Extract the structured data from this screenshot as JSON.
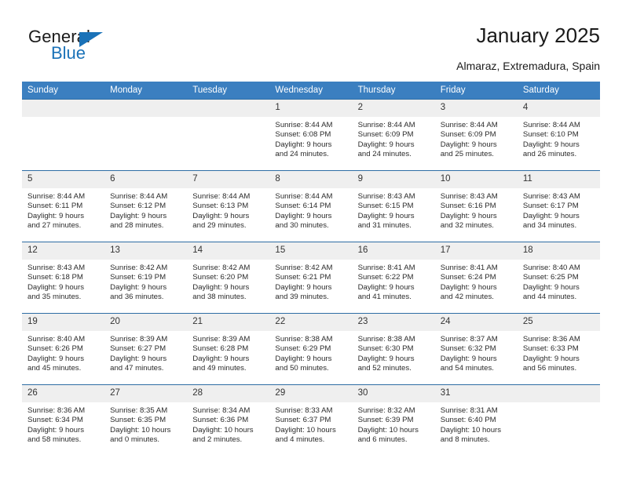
{
  "logo": {
    "word1": "General",
    "word2": "Blue",
    "triangle_color": "#1a72b8"
  },
  "header": {
    "title": "January 2025",
    "location": "Almaraz, Extremadura, Spain"
  },
  "theme": {
    "header_blue": "#3b7fc0",
    "border_blue": "#2e6da4",
    "daynum_bg": "#efefef",
    "text": "#2b2b2b"
  },
  "weekday_headers": [
    "Sunday",
    "Monday",
    "Tuesday",
    "Wednesday",
    "Thursday",
    "Friday",
    "Saturday"
  ],
  "weeks": [
    [
      {
        "day": "",
        "blank": true,
        "sunrise": "",
        "sunset": "",
        "daylight1": "",
        "daylight2": ""
      },
      {
        "day": "",
        "blank": true,
        "sunrise": "",
        "sunset": "",
        "daylight1": "",
        "daylight2": ""
      },
      {
        "day": "",
        "blank": true,
        "sunrise": "",
        "sunset": "",
        "daylight1": "",
        "daylight2": ""
      },
      {
        "day": "1",
        "blank": false,
        "sunrise": "Sunrise: 8:44 AM",
        "sunset": "Sunset: 6:08 PM",
        "daylight1": "Daylight: 9 hours",
        "daylight2": "and 24 minutes."
      },
      {
        "day": "2",
        "blank": false,
        "sunrise": "Sunrise: 8:44 AM",
        "sunset": "Sunset: 6:09 PM",
        "daylight1": "Daylight: 9 hours",
        "daylight2": "and 24 minutes."
      },
      {
        "day": "3",
        "blank": false,
        "sunrise": "Sunrise: 8:44 AM",
        "sunset": "Sunset: 6:09 PM",
        "daylight1": "Daylight: 9 hours",
        "daylight2": "and 25 minutes."
      },
      {
        "day": "4",
        "blank": false,
        "sunrise": "Sunrise: 8:44 AM",
        "sunset": "Sunset: 6:10 PM",
        "daylight1": "Daylight: 9 hours",
        "daylight2": "and 26 minutes."
      }
    ],
    [
      {
        "day": "5",
        "blank": false,
        "sunrise": "Sunrise: 8:44 AM",
        "sunset": "Sunset: 6:11 PM",
        "daylight1": "Daylight: 9 hours",
        "daylight2": "and 27 minutes."
      },
      {
        "day": "6",
        "blank": false,
        "sunrise": "Sunrise: 8:44 AM",
        "sunset": "Sunset: 6:12 PM",
        "daylight1": "Daylight: 9 hours",
        "daylight2": "and 28 minutes."
      },
      {
        "day": "7",
        "blank": false,
        "sunrise": "Sunrise: 8:44 AM",
        "sunset": "Sunset: 6:13 PM",
        "daylight1": "Daylight: 9 hours",
        "daylight2": "and 29 minutes."
      },
      {
        "day": "8",
        "blank": false,
        "sunrise": "Sunrise: 8:44 AM",
        "sunset": "Sunset: 6:14 PM",
        "daylight1": "Daylight: 9 hours",
        "daylight2": "and 30 minutes."
      },
      {
        "day": "9",
        "blank": false,
        "sunrise": "Sunrise: 8:43 AM",
        "sunset": "Sunset: 6:15 PM",
        "daylight1": "Daylight: 9 hours",
        "daylight2": "and 31 minutes."
      },
      {
        "day": "10",
        "blank": false,
        "sunrise": "Sunrise: 8:43 AM",
        "sunset": "Sunset: 6:16 PM",
        "daylight1": "Daylight: 9 hours",
        "daylight2": "and 32 minutes."
      },
      {
        "day": "11",
        "blank": false,
        "sunrise": "Sunrise: 8:43 AM",
        "sunset": "Sunset: 6:17 PM",
        "daylight1": "Daylight: 9 hours",
        "daylight2": "and 34 minutes."
      }
    ],
    [
      {
        "day": "12",
        "blank": false,
        "sunrise": "Sunrise: 8:43 AM",
        "sunset": "Sunset: 6:18 PM",
        "daylight1": "Daylight: 9 hours",
        "daylight2": "and 35 minutes."
      },
      {
        "day": "13",
        "blank": false,
        "sunrise": "Sunrise: 8:42 AM",
        "sunset": "Sunset: 6:19 PM",
        "daylight1": "Daylight: 9 hours",
        "daylight2": "and 36 minutes."
      },
      {
        "day": "14",
        "blank": false,
        "sunrise": "Sunrise: 8:42 AM",
        "sunset": "Sunset: 6:20 PM",
        "daylight1": "Daylight: 9 hours",
        "daylight2": "and 38 minutes."
      },
      {
        "day": "15",
        "blank": false,
        "sunrise": "Sunrise: 8:42 AM",
        "sunset": "Sunset: 6:21 PM",
        "daylight1": "Daylight: 9 hours",
        "daylight2": "and 39 minutes."
      },
      {
        "day": "16",
        "blank": false,
        "sunrise": "Sunrise: 8:41 AM",
        "sunset": "Sunset: 6:22 PM",
        "daylight1": "Daylight: 9 hours",
        "daylight2": "and 41 minutes."
      },
      {
        "day": "17",
        "blank": false,
        "sunrise": "Sunrise: 8:41 AM",
        "sunset": "Sunset: 6:24 PM",
        "daylight1": "Daylight: 9 hours",
        "daylight2": "and 42 minutes."
      },
      {
        "day": "18",
        "blank": false,
        "sunrise": "Sunrise: 8:40 AM",
        "sunset": "Sunset: 6:25 PM",
        "daylight1": "Daylight: 9 hours",
        "daylight2": "and 44 minutes."
      }
    ],
    [
      {
        "day": "19",
        "blank": false,
        "sunrise": "Sunrise: 8:40 AM",
        "sunset": "Sunset: 6:26 PM",
        "daylight1": "Daylight: 9 hours",
        "daylight2": "and 45 minutes."
      },
      {
        "day": "20",
        "blank": false,
        "sunrise": "Sunrise: 8:39 AM",
        "sunset": "Sunset: 6:27 PM",
        "daylight1": "Daylight: 9 hours",
        "daylight2": "and 47 minutes."
      },
      {
        "day": "21",
        "blank": false,
        "sunrise": "Sunrise: 8:39 AM",
        "sunset": "Sunset: 6:28 PM",
        "daylight1": "Daylight: 9 hours",
        "daylight2": "and 49 minutes."
      },
      {
        "day": "22",
        "blank": false,
        "sunrise": "Sunrise: 8:38 AM",
        "sunset": "Sunset: 6:29 PM",
        "daylight1": "Daylight: 9 hours",
        "daylight2": "and 50 minutes."
      },
      {
        "day": "23",
        "blank": false,
        "sunrise": "Sunrise: 8:38 AM",
        "sunset": "Sunset: 6:30 PM",
        "daylight1": "Daylight: 9 hours",
        "daylight2": "and 52 minutes."
      },
      {
        "day": "24",
        "blank": false,
        "sunrise": "Sunrise: 8:37 AM",
        "sunset": "Sunset: 6:32 PM",
        "daylight1": "Daylight: 9 hours",
        "daylight2": "and 54 minutes."
      },
      {
        "day": "25",
        "blank": false,
        "sunrise": "Sunrise: 8:36 AM",
        "sunset": "Sunset: 6:33 PM",
        "daylight1": "Daylight: 9 hours",
        "daylight2": "and 56 minutes."
      }
    ],
    [
      {
        "day": "26",
        "blank": false,
        "sunrise": "Sunrise: 8:36 AM",
        "sunset": "Sunset: 6:34 PM",
        "daylight1": "Daylight: 9 hours",
        "daylight2": "and 58 minutes."
      },
      {
        "day": "27",
        "blank": false,
        "sunrise": "Sunrise: 8:35 AM",
        "sunset": "Sunset: 6:35 PM",
        "daylight1": "Daylight: 10 hours",
        "daylight2": "and 0 minutes."
      },
      {
        "day": "28",
        "blank": false,
        "sunrise": "Sunrise: 8:34 AM",
        "sunset": "Sunset: 6:36 PM",
        "daylight1": "Daylight: 10 hours",
        "daylight2": "and 2 minutes."
      },
      {
        "day": "29",
        "blank": false,
        "sunrise": "Sunrise: 8:33 AM",
        "sunset": "Sunset: 6:37 PM",
        "daylight1": "Daylight: 10 hours",
        "daylight2": "and 4 minutes."
      },
      {
        "day": "30",
        "blank": false,
        "sunrise": "Sunrise: 8:32 AM",
        "sunset": "Sunset: 6:39 PM",
        "daylight1": "Daylight: 10 hours",
        "daylight2": "and 6 minutes."
      },
      {
        "day": "31",
        "blank": false,
        "sunrise": "Sunrise: 8:31 AM",
        "sunset": "Sunset: 6:40 PM",
        "daylight1": "Daylight: 10 hours",
        "daylight2": "and 8 minutes."
      },
      {
        "day": "",
        "blank": true,
        "sunrise": "",
        "sunset": "",
        "daylight1": "",
        "daylight2": ""
      }
    ]
  ]
}
